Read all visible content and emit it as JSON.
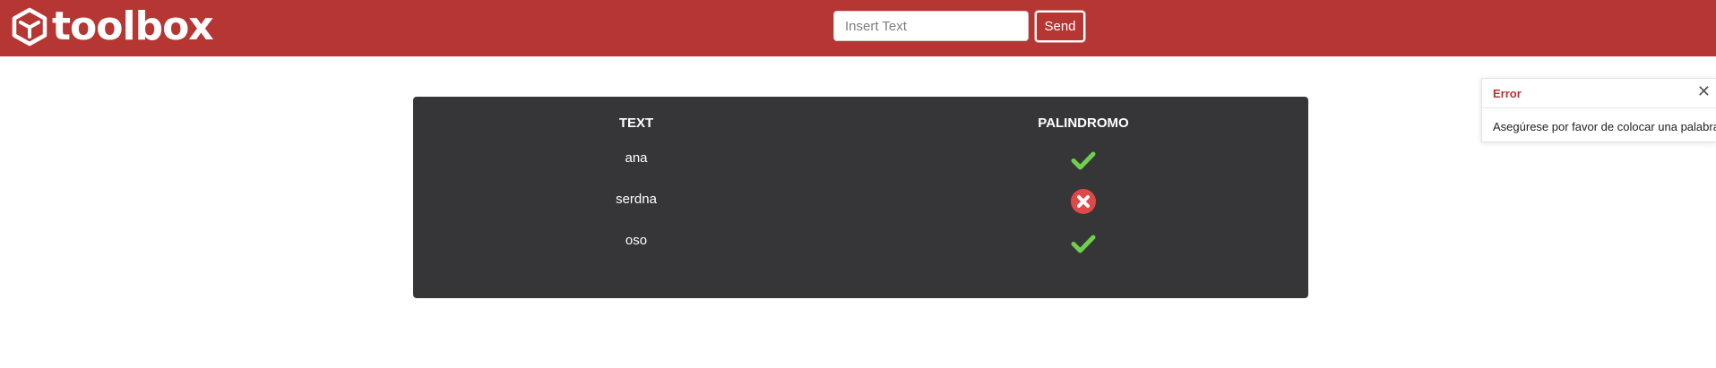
{
  "navbar": {
    "brand": "toolbox",
    "brand_logo_icon": "cube-icon",
    "background_color": "#b63634"
  },
  "search": {
    "placeholder": "Insert Text",
    "value": ""
  },
  "send_button": {
    "label": "Send"
  },
  "table": {
    "headers": [
      "TEXT",
      "PALINDROMO"
    ],
    "rows": [
      {
        "text": "ana",
        "palindromo": true,
        "icon": "check-icon"
      },
      {
        "text": "serdna",
        "palindromo": false,
        "icon": "x-circle-icon"
      },
      {
        "text": "oso",
        "palindromo": true,
        "icon": "check-icon"
      }
    ],
    "background_color": "#363638"
  },
  "toast": {
    "title": "Error",
    "message": "Asegúrese por favor de colocar una palabra",
    "close_icon": "close-icon"
  },
  "colors": {
    "check": "#6fd04b",
    "error": "#e04848"
  }
}
